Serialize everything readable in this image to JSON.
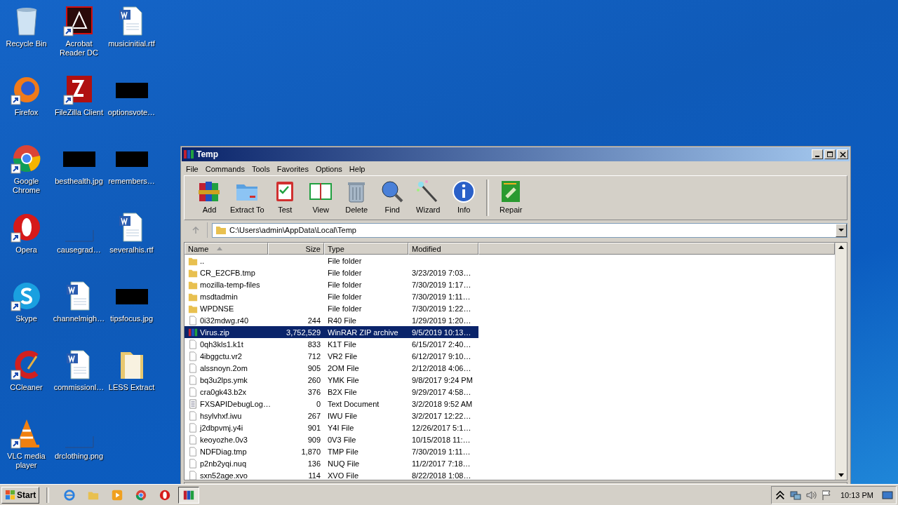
{
  "desktop_icons": [
    {
      "label": "Recycle Bin",
      "kind": "recycle",
      "shortcut": false
    },
    {
      "label": "Acrobat Reader DC",
      "kind": "acrobat",
      "shortcut": true
    },
    {
      "label": "musicinitial.rtf",
      "kind": "word",
      "shortcut": false
    },
    {
      "label": "Firefox",
      "kind": "firefox",
      "shortcut": true
    },
    {
      "label": "FileZilla Client",
      "kind": "filezilla",
      "shortcut": true
    },
    {
      "label": "optionsvote…",
      "kind": "black",
      "shortcut": false
    },
    {
      "label": "Google Chrome",
      "kind": "chrome",
      "shortcut": true
    },
    {
      "label": "besthealth.jpg",
      "kind": "black",
      "shortcut": false
    },
    {
      "label": "remembers…",
      "kind": "black",
      "shortcut": false
    },
    {
      "label": "Opera",
      "kind": "opera",
      "shortcut": true
    },
    {
      "label": "causegrad…",
      "kind": "blank",
      "shortcut": false
    },
    {
      "label": "severalhis.rtf",
      "kind": "word",
      "shortcut": false
    },
    {
      "label": "Skype",
      "kind": "skype",
      "shortcut": true
    },
    {
      "label": "channelmigh…",
      "kind": "word",
      "shortcut": false
    },
    {
      "label": "tipsfocus.jpg",
      "kind": "black",
      "shortcut": false
    },
    {
      "label": "CCleaner",
      "kind": "ccleaner",
      "shortcut": true
    },
    {
      "label": "commissionl…",
      "kind": "word",
      "shortcut": false
    },
    {
      "label": "LESS Extract",
      "kind": "folder",
      "shortcut": false
    },
    {
      "label": "VLC media player",
      "kind": "vlc",
      "shortcut": true
    },
    {
      "label": "drclothing.png",
      "kind": "blank",
      "shortcut": false
    }
  ],
  "window": {
    "title": "Temp",
    "menu": [
      "File",
      "Commands",
      "Tools",
      "Favorites",
      "Options",
      "Help"
    ],
    "toolbar": [
      {
        "label": "Add",
        "kind": "add"
      },
      {
        "label": "Extract To",
        "kind": "extract"
      },
      {
        "label": "Test",
        "kind": "test"
      },
      {
        "label": "View",
        "kind": "view"
      },
      {
        "label": "Delete",
        "kind": "delete"
      },
      {
        "label": "Find",
        "kind": "find"
      },
      {
        "label": "Wizard",
        "kind": "wizard"
      },
      {
        "label": "Info",
        "kind": "info"
      },
      {
        "label": "Repair",
        "kind": "repair"
      }
    ],
    "address": "C:\\Users\\admin\\AppData\\Local\\Temp",
    "columns": [
      {
        "label": "Name",
        "sorted": true
      },
      {
        "label": "Size",
        "sorted": false
      },
      {
        "label": "Type",
        "sorted": false
      },
      {
        "label": "Modified",
        "sorted": false
      }
    ],
    "rows": [
      {
        "name": "..",
        "size": "",
        "type": "File folder",
        "modified": "",
        "kind": "folder",
        "selected": false
      },
      {
        "name": "CR_E2CFB.tmp",
        "size": "",
        "type": "File folder",
        "modified": "3/23/2019 7:03…",
        "kind": "folder",
        "selected": false
      },
      {
        "name": "mozilla-temp-files",
        "size": "",
        "type": "File folder",
        "modified": "7/30/2019 1:17…",
        "kind": "folder",
        "selected": false
      },
      {
        "name": "msdtadmin",
        "size": "",
        "type": "File folder",
        "modified": "7/30/2019 1:11…",
        "kind": "folder",
        "selected": false
      },
      {
        "name": "WPDNSE",
        "size": "",
        "type": "File folder",
        "modified": "7/30/2019 1:22…",
        "kind": "folder",
        "selected": false
      },
      {
        "name": "0i32mdwg.r40",
        "size": "244",
        "type": "R40 File",
        "modified": "1/29/2019 1:20…",
        "kind": "file",
        "selected": false
      },
      {
        "name": "Virus.zip",
        "size": "3,752,529",
        "type": "WinRAR ZIP archive",
        "modified": "9/5/2019 10:13…",
        "kind": "archive",
        "selected": true
      },
      {
        "name": "0qh3kls1.k1t",
        "size": "833",
        "type": "K1T File",
        "modified": "6/15/2017 2:40…",
        "kind": "file",
        "selected": false
      },
      {
        "name": "4ibggctu.vr2",
        "size": "712",
        "type": "VR2 File",
        "modified": "6/12/2017 9:10…",
        "kind": "file",
        "selected": false
      },
      {
        "name": "alssnoyn.2om",
        "size": "905",
        "type": "2OM File",
        "modified": "2/12/2018 4:06…",
        "kind": "file",
        "selected": false
      },
      {
        "name": "bq3u2lps.ymk",
        "size": "260",
        "type": "YMK File",
        "modified": "9/8/2017 9:24 PM",
        "kind": "file",
        "selected": false
      },
      {
        "name": "cra0gk43.b2x",
        "size": "376",
        "type": "B2X File",
        "modified": "9/29/2017 4:58…",
        "kind": "file",
        "selected": false
      },
      {
        "name": "FXSAPIDebugLog…",
        "size": "0",
        "type": "Text Document",
        "modified": "3/2/2018 9:52 AM",
        "kind": "text",
        "selected": false
      },
      {
        "name": "hsylvhxf.iwu",
        "size": "267",
        "type": "IWU File",
        "modified": "3/2/2017 12:22…",
        "kind": "file",
        "selected": false
      },
      {
        "name": "j2dbpvmj.y4i",
        "size": "901",
        "type": "Y4I File",
        "modified": "12/26/2017 5:1…",
        "kind": "file",
        "selected": false
      },
      {
        "name": "keoyozhe.0v3",
        "size": "909",
        "type": "0V3 File",
        "modified": "10/15/2018 11:…",
        "kind": "file",
        "selected": false
      },
      {
        "name": "NDFDiag.tmp",
        "size": "1,870",
        "type": "TMP File",
        "modified": "7/30/2019 1:11…",
        "kind": "file",
        "selected": false
      },
      {
        "name": "p2nb2yqi.nuq",
        "size": "136",
        "type": "NUQ File",
        "modified": "11/2/2017 7:18…",
        "kind": "file",
        "selected": false
      },
      {
        "name": "sxn52age.xvo",
        "size": "114",
        "type": "XVO File",
        "modified": "8/22/2018 1:08…",
        "kind": "file",
        "selected": false
      }
    ]
  },
  "taskbar": {
    "start": "Start",
    "apps": [
      {
        "kind": "ie",
        "active": false
      },
      {
        "kind": "explorer",
        "active": false
      },
      {
        "kind": "media",
        "active": false
      },
      {
        "kind": "chrome",
        "active": false
      },
      {
        "kind": "opera",
        "active": false
      },
      {
        "kind": "winrar",
        "active": true
      }
    ],
    "clock": "10:13 PM"
  }
}
